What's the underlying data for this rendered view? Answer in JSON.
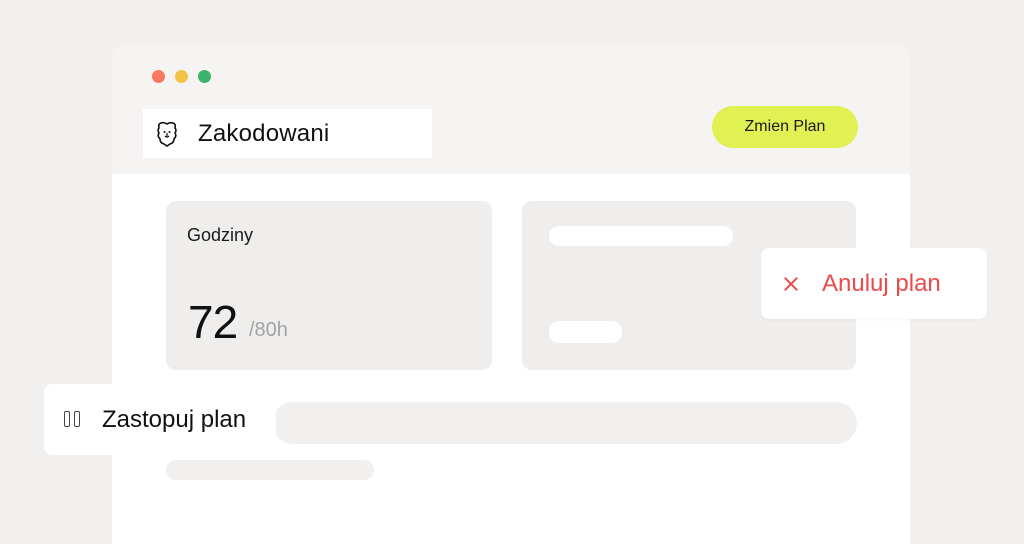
{
  "header": {
    "brand_name": "Zakodowani",
    "change_plan_label": "Zmien Plan"
  },
  "hours_card": {
    "label": "Godziny",
    "used": "72",
    "total": "/80h"
  },
  "actions": {
    "cancel_label": "Anuluj plan",
    "replace_label": "Zastopuj plan"
  },
  "colors": {
    "accent": "#e1f052",
    "danger": "#e94a4a",
    "background": "#f1f0ee"
  },
  "icons": {
    "brand": "lion-logo-icon",
    "cancel": "close-icon",
    "replace": "pause-icon"
  }
}
